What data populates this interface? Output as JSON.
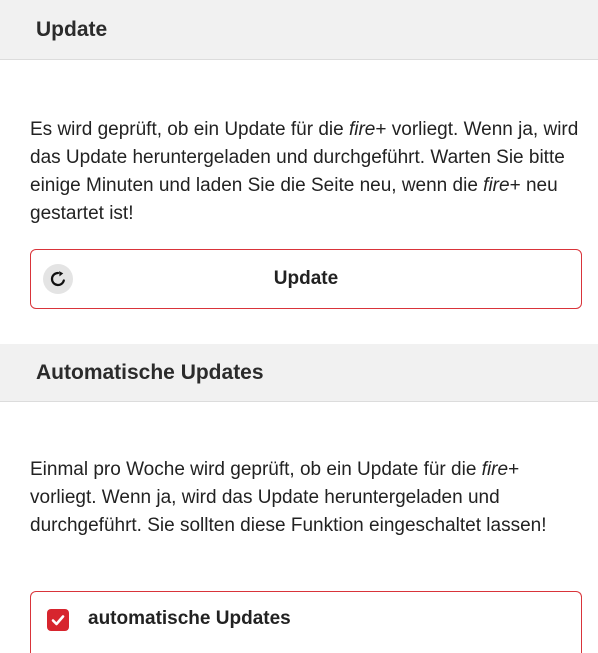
{
  "update_section": {
    "title": "Update",
    "desc_part1": "Es wird geprüft, ob ein Update für die ",
    "desc_brand1": "fire",
    "desc_plus1": "+",
    "desc_part2": " vorliegt. Wenn ja, wird das Update heruntergeladen und durchgeführt. Warten Sie bitte einige Minuten und laden Sie die Seite neu, wenn die ",
    "desc_brand2": "fire",
    "desc_plus2": "+",
    "desc_part3": " neu gestartet ist!",
    "button_label": "Update",
    "button_icon": "refresh-icon"
  },
  "auto_update_section": {
    "title": "Automatische Updates",
    "desc_part1": "Einmal pro Woche wird geprüft, ob ein Update für die ",
    "desc_brand": "fire",
    "desc_plus": "+",
    "desc_part2": " vorliegt. Wenn ja, wird das Update heruntergeladen und durchgeführt. Sie sollten diese Funktion eingeschaltet lassen!",
    "checkbox_label": "automatische Updates",
    "checkbox_checked": true
  },
  "colors": {
    "accent": "#d7252e",
    "border": "#d9343a",
    "header_bg": "#f1f1f1"
  }
}
